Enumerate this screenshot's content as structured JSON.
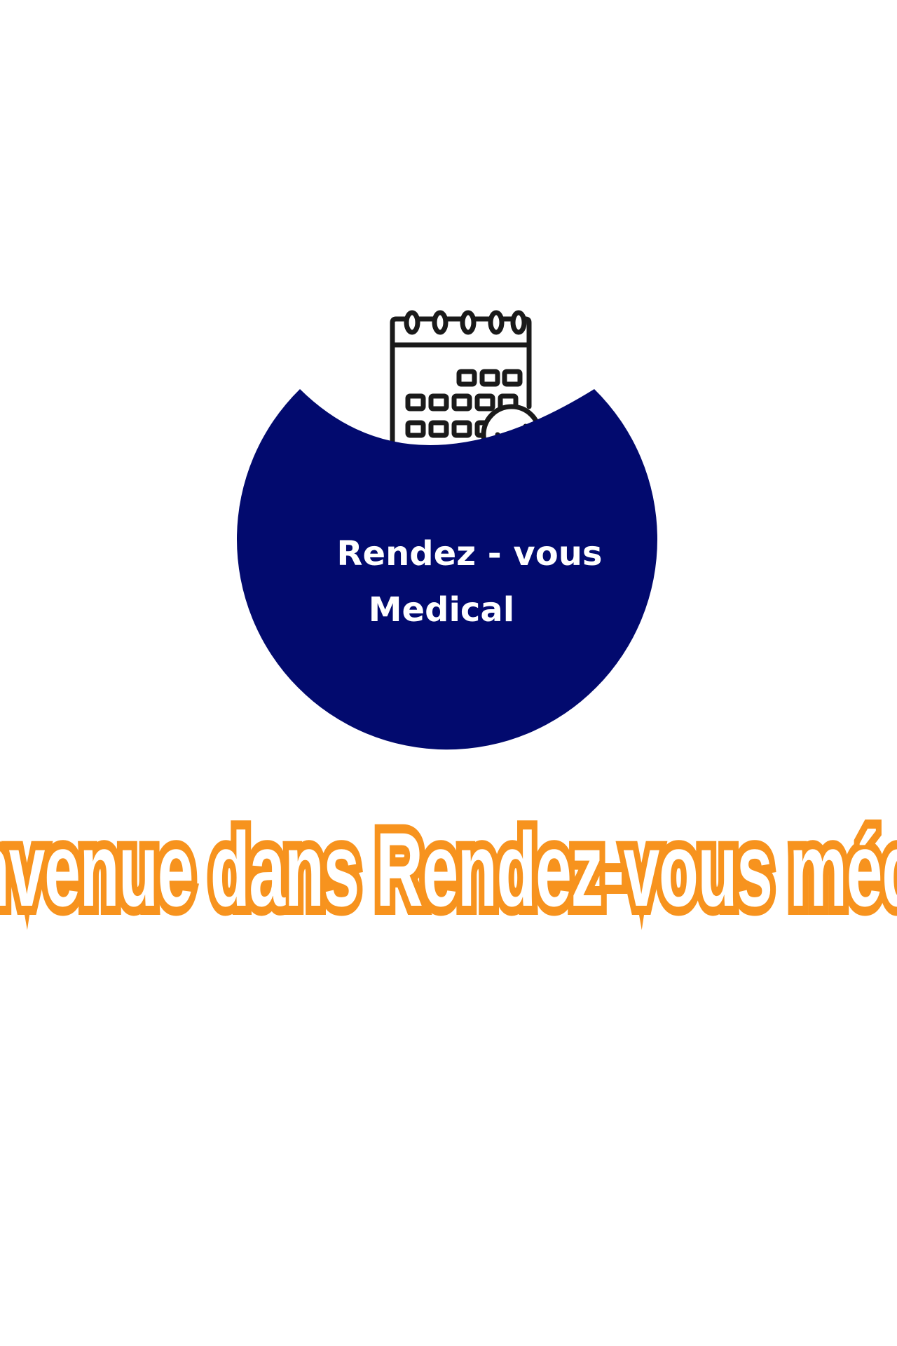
{
  "logo": {
    "line1": "Rendez - vous",
    "line2": "Medical",
    "icon": "calendar-check-icon",
    "colors": {
      "badge": "#020a6e",
      "calendar_stroke": "#1a1a1a",
      "text": "#ffffff"
    }
  },
  "welcome": {
    "text": "Bienvenue dans Rendez-vous médical",
    "colors": {
      "fill": "#ffffff",
      "outline": "#f7931e"
    }
  }
}
